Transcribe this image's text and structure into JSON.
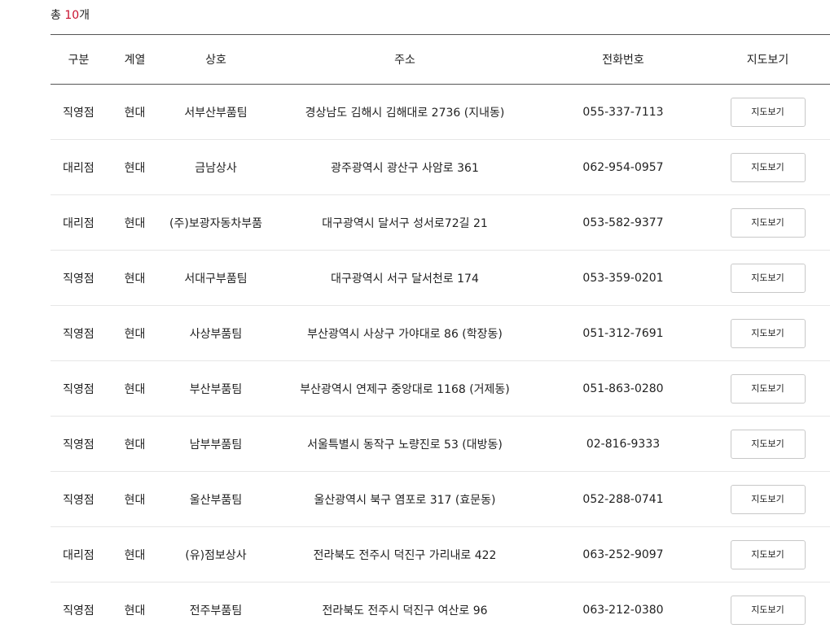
{
  "summary": {
    "prefix": "총 ",
    "count": "10",
    "suffix": "개"
  },
  "table": {
    "headers": [
      "구분",
      "계열",
      "상호",
      "주소",
      "전화번호",
      "지도보기"
    ],
    "button_label": "지도보기",
    "rows": [
      {
        "type": "직영점",
        "brand": "현대",
        "name": "서부산부품팀",
        "address": "경상남도 김해시 김해대로 2736 (지내동)",
        "phone": "055-337-7113"
      },
      {
        "type": "대리점",
        "brand": "현대",
        "name": "금남상사",
        "address": "광주광역시 광산구 사암로 361",
        "phone": "062-954-0957"
      },
      {
        "type": "대리점",
        "brand": "현대",
        "name": "(주)보광자동차부품",
        "address": "대구광역시 달서구 성서로72길 21",
        "phone": "053-582-9377"
      },
      {
        "type": "직영점",
        "brand": "현대",
        "name": "서대구부품팀",
        "address": "대구광역시 서구 달서천로 174",
        "phone": "053-359-0201"
      },
      {
        "type": "직영점",
        "brand": "현대",
        "name": "사상부품팀",
        "address": "부산광역시 사상구 가야대로 86 (학장동)",
        "phone": "051-312-7691"
      },
      {
        "type": "직영점",
        "brand": "현대",
        "name": "부산부품팀",
        "address": "부산광역시 연제구 중앙대로 1168 (거제동)",
        "phone": "051-863-0280"
      },
      {
        "type": "직영점",
        "brand": "현대",
        "name": "남부부품팀",
        "address": "서울특별시 동작구 노량진로 53 (대방동)",
        "phone": "02-816-9333"
      },
      {
        "type": "직영점",
        "brand": "현대",
        "name": "울산부품팀",
        "address": "울산광역시 북구 염포로 317 (효문동)",
        "phone": "052-288-0741"
      },
      {
        "type": "대리점",
        "brand": "현대",
        "name": "(유)점보상사",
        "address": "전라북도 전주시 덕진구 가리내로 422",
        "phone": "063-252-9097"
      },
      {
        "type": "직영점",
        "brand": "현대",
        "name": "전주부품팀",
        "address": "전라북도 전주시 덕진구 여산로 96",
        "phone": "063-212-0380"
      }
    ]
  }
}
